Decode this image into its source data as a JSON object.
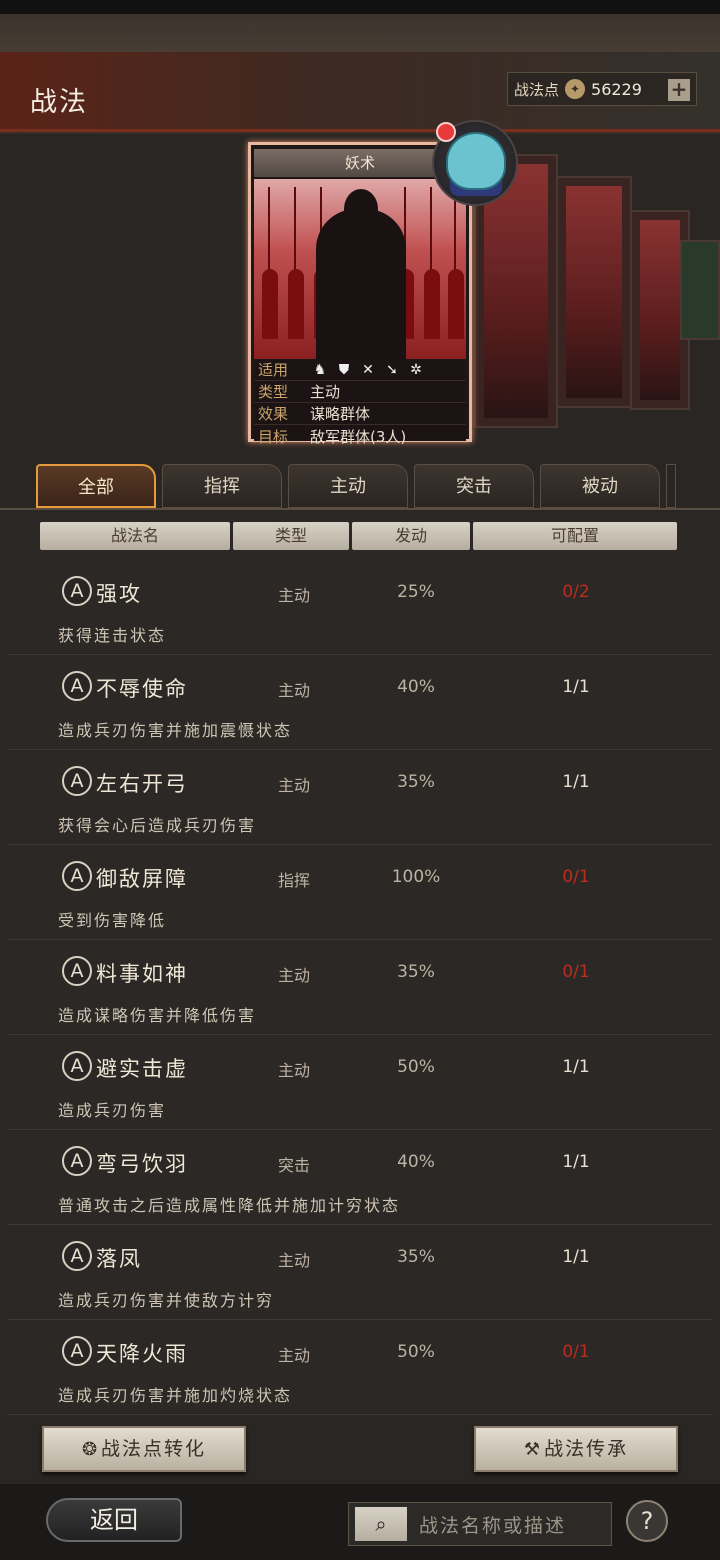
{
  "header": {
    "title": "战法",
    "points_label": "战法点",
    "points_value": "56229",
    "plus": "+"
  },
  "card": {
    "name": "妖术",
    "info": [
      {
        "key": "适用",
        "value": ""
      },
      {
        "key": "类型",
        "value": "主动"
      },
      {
        "key": "效果",
        "value": "谋略群体"
      },
      {
        "key": "目标",
        "value": "敌军群体(3人)"
      }
    ],
    "use_icons": [
      "cavalry-icon",
      "shield-icon",
      "bow-icon",
      "spear-icon",
      "wheel-icon"
    ]
  },
  "tabs": [
    {
      "label": "全部",
      "active": true
    },
    {
      "label": "指挥",
      "active": false
    },
    {
      "label": "主动",
      "active": false
    },
    {
      "label": "突击",
      "active": false
    },
    {
      "label": "被动",
      "active": false
    }
  ],
  "columns": [
    "战法名",
    "类型",
    "发动",
    "可配置"
  ],
  "rows": [
    {
      "badge": "A",
      "name": "强攻",
      "type": "主动",
      "rate": "25%",
      "conf": "0/2",
      "conf_red": true,
      "desc": "获得连击状态"
    },
    {
      "badge": "A",
      "name": "不辱使命",
      "type": "主动",
      "rate": "40%",
      "conf": "1/1",
      "conf_red": false,
      "desc": "造成兵刃伤害并施加震慑状态"
    },
    {
      "badge": "A",
      "name": "左右开弓",
      "type": "主动",
      "rate": "35%",
      "conf": "1/1",
      "conf_red": false,
      "desc": "获得会心后造成兵刃伤害"
    },
    {
      "badge": "A",
      "name": "御敌屏障",
      "type": "指挥",
      "rate": "100%",
      "conf": "0/1",
      "conf_red": true,
      "desc": "受到伤害降低"
    },
    {
      "badge": "A",
      "name": "料事如神",
      "type": "主动",
      "rate": "35%",
      "conf": "0/1",
      "conf_red": true,
      "desc": "造成谋略伤害并降低伤害"
    },
    {
      "badge": "A",
      "name": "避实击虚",
      "type": "主动",
      "rate": "50%",
      "conf": "1/1",
      "conf_red": false,
      "desc": "造成兵刃伤害"
    },
    {
      "badge": "A",
      "name": "弯弓饮羽",
      "type": "突击",
      "rate": "40%",
      "conf": "1/1",
      "conf_red": false,
      "desc": "普通攻击之后造成属性降低并施加计穷状态"
    },
    {
      "badge": "A",
      "name": "落凤",
      "type": "主动",
      "rate": "35%",
      "conf": "1/1",
      "conf_red": false,
      "desc": "造成兵刃伤害并使敌方计穷"
    },
    {
      "badge": "A",
      "name": "天降火雨",
      "type": "主动",
      "rate": "50%",
      "conf": "0/1",
      "conf_red": true,
      "desc": "造成兵刃伤害并施加灼烧状态"
    }
  ],
  "buttons": {
    "convert": "战法点转化",
    "inherit": "战法传承",
    "back": "返回",
    "search_placeholder": "战法名称或描述",
    "help": "?"
  },
  "colors": {
    "accent_orange": "#e69a3a",
    "conf_red": "#c02a1f"
  }
}
